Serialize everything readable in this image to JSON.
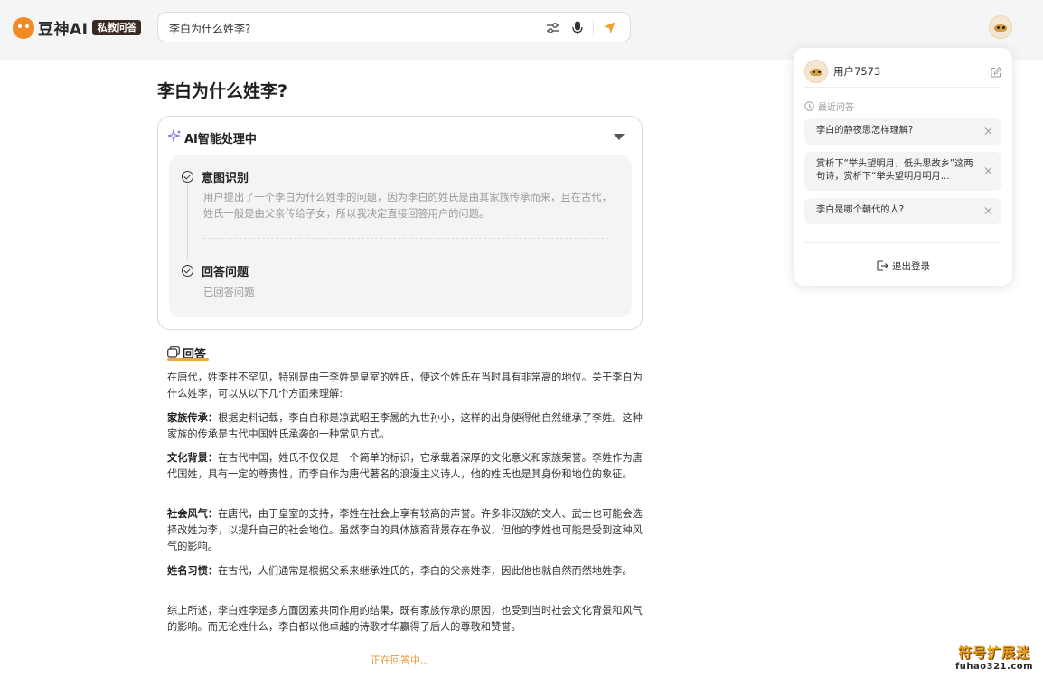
{
  "header": {
    "logo_text": "豆神AI",
    "logo_badge": "私教问答",
    "search_value": "李白为什么姓李?"
  },
  "question": {
    "title": "李白为什么姓李?"
  },
  "processing": {
    "title": "AI智能处理中",
    "steps": [
      {
        "label": "意图识别",
        "text": "用户提出了一个李白为什么姓李的问题，因为李白的姓氏是由其家族传承而来，且在古代，姓氏一般是由父亲传给子女，所以我决定直接回答用户的问题。"
      },
      {
        "label": "回答问题",
        "text": "已回答问题"
      }
    ]
  },
  "answer": {
    "heading": "回答",
    "intro": "在唐代，姓李并不罕见，特别是由于李姓是皇室的姓氏，使这个姓氏在当时具有非常高的地位。关于李白为什么姓李，可以从以下几个方面来理解:",
    "points": [
      {
        "term": "家族传承：",
        "text": "根据史料记载，李白自称是凉武昭王李暠的九世孙小，这样的出身使得他自然继承了李姓。这种家族的传承是古代中国姓氏承袭的一种常见方式。"
      },
      {
        "term": "文化背景：",
        "text": "在古代中国，姓氏不仅仅是一个简单的标识，它承载着深厚的文化意义和家族荣誉。李姓作为唐代国姓，具有一定的尊贵性，而李白作为唐代著名的浪漫主义诗人，他的姓氏也是其身份和地位的象征。"
      },
      {
        "term": "社会风气：",
        "text": "在唐代，由于皇室的支持，李姓在社会上享有较高的声誉。许多非汉族的文人、武士也可能会选择改姓为李，以提升自己的社会地位。虽然李白的具体族裔背景存在争议，但他的李姓也可能是受到这种风气的影响。"
      },
      {
        "term": "姓名习惯：",
        "text": "在古代，人们通常是根据父系来继承姓氏的，李白的父亲姓李，因此他也就自然而然地姓李。"
      }
    ],
    "conclusion": "综上所述，李白姓李是多方面因素共同作用的结果，既有家族传承的原因，也受到当时社会文化背景和风气的影响。而无论姓什么，李白都以他卓越的诗歌才华赢得了后人的尊敬和赞誉。",
    "status": "正在回答中..."
  },
  "user_panel": {
    "username": "用户7573",
    "recent_label": "最近问答",
    "history": [
      {
        "text": "李白的静夜思怎样理解?"
      },
      {
        "text": "赏析下“举头望明月，低头思故乡”这两句诗，赏析下“举头望明月明月..."
      },
      {
        "text": "李白是哪个朝代的人?"
      }
    ],
    "logout_label": "退出登录"
  },
  "watermark": {
    "line1": "符号扩展迷",
    "line2": "fuhao321.com"
  },
  "colors": {
    "accent": "#f2a541",
    "brand": "#f08a24",
    "send": "#f0a030"
  },
  "icons": [
    "logo-icon",
    "settings-sliders-icon",
    "microphone-icon",
    "send-icon",
    "avatar",
    "sparkle-icon",
    "caret-down-icon",
    "check-circle-icon",
    "answer-icon",
    "edit-icon",
    "clock-icon",
    "close-icon",
    "logout-icon"
  ]
}
